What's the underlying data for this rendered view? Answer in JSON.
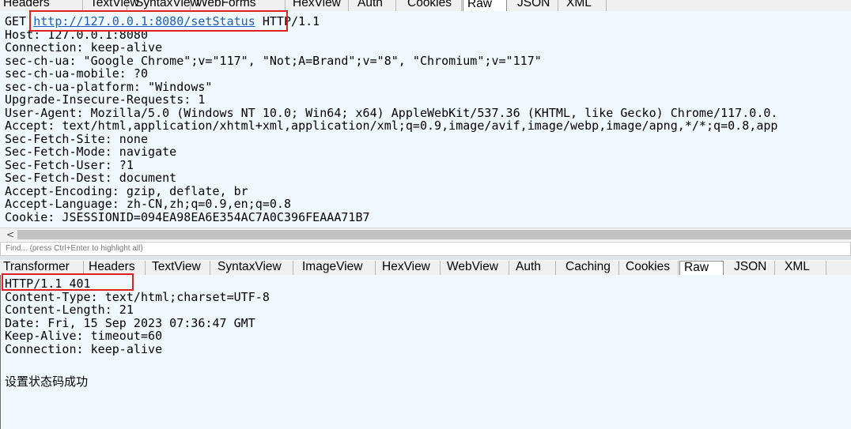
{
  "request": {
    "tabs": [
      "Headers",
      "TextView",
      "SyntaxView",
      "WebForms",
      "HexView",
      "Auth",
      "Cookies",
      "Raw",
      "JSON",
      "XML"
    ],
    "selected_tab": "Raw",
    "request_line": {
      "method": "GET ",
      "url": "http://127.0.0.1:8080/setStatus",
      "protocol": " HTTP/1.1"
    },
    "headers": [
      "Host: 127.0.0.1:8080",
      "Connection: keep-alive",
      "sec-ch-ua: \"Google Chrome\";v=\"117\", \"Not;A=Brand\";v=\"8\", \"Chromium\";v=\"117\"",
      "sec-ch-ua-mobile: ?0",
      "sec-ch-ua-platform: \"Windows\"",
      "Upgrade-Insecure-Requests: 1",
      "User-Agent: Mozilla/5.0 (Windows NT 10.0; Win64; x64) AppleWebKit/537.36 (KHTML, like Gecko) Chrome/117.0.0.",
      "Accept: text/html,application/xhtml+xml,application/xml;q=0.9,image/avif,image/webp,image/apng,*/*;q=0.8,app",
      "Sec-Fetch-Site: none",
      "Sec-Fetch-Mode: navigate",
      "Sec-Fetch-User: ?1",
      "Sec-Fetch-Dest: document",
      "Accept-Encoding: gzip, deflate, br",
      "Accept-Language: zh-CN,zh;q=0.9,en;q=0.8",
      "Cookie: JSESSIONID=094EA98EA6E354AC7A0C396FEAAA71B7"
    ]
  },
  "find": {
    "placeholder": "Find... (press Ctrl+Enter to highlight all)"
  },
  "response": {
    "tabs": [
      "Transformer",
      "Headers",
      "TextView",
      "SyntaxView",
      "ImageView",
      "HexView",
      "WebView",
      "Auth",
      "Caching",
      "Cookies",
      "Raw",
      "JSON",
      "XML"
    ],
    "selected_tab": "Raw",
    "status_line": "HTTP/1.1 401",
    "headers": [
      "Content-Type: text/html;charset=UTF-8",
      "Content-Length: 21",
      "Date: Fri, 15 Sep 2023 07:36:47 GMT",
      "Keep-Alive: timeout=60",
      "Connection: keep-alive"
    ],
    "body": "设置状态码成功"
  },
  "colors": {
    "highlight": "#e02020",
    "pane_bg": "#f0f8ff",
    "link": "#1e5fb4"
  },
  "icons": {
    "scroll_left": "chevron-left-icon"
  }
}
